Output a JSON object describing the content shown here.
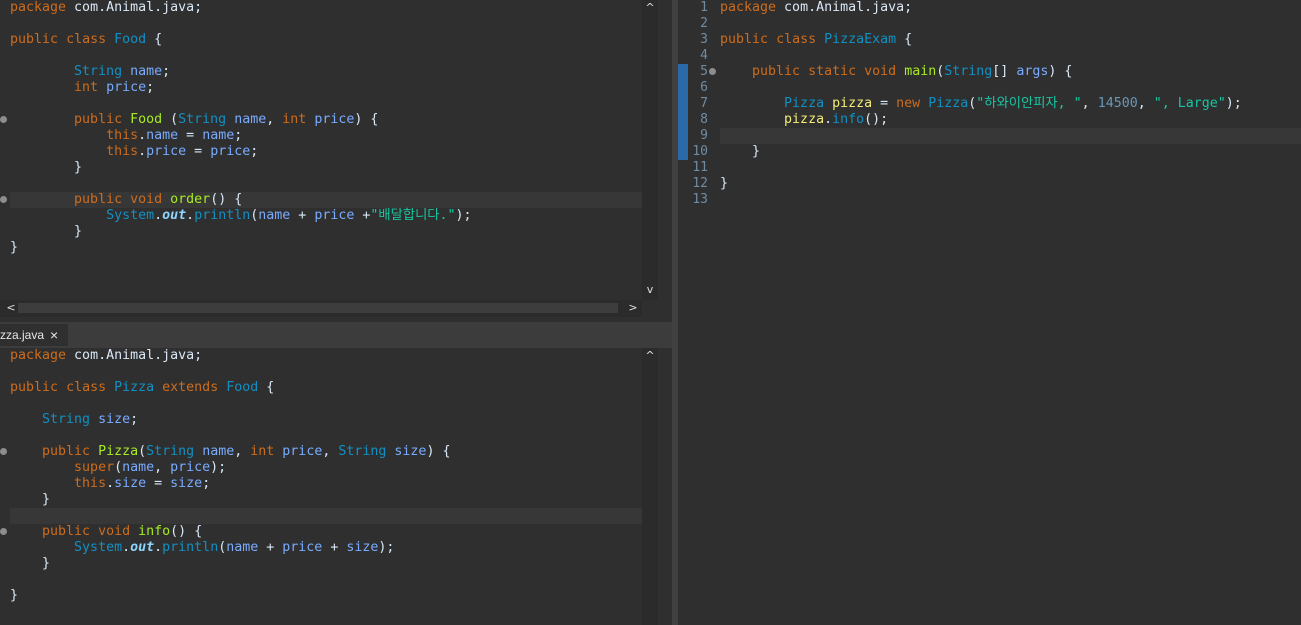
{
  "editors": {
    "food": {
      "lines": [
        [
          [
            "kw",
            "package"
          ],
          [
            "def",
            " com.Animal.java;"
          ]
        ],
        [],
        [
          [
            "kw",
            "public"
          ],
          [
            "def",
            " "
          ],
          [
            "kw",
            "class"
          ],
          [
            "def",
            " "
          ],
          [
            "cls",
            "Food"
          ],
          [
            "def",
            " {"
          ]
        ],
        [],
        [
          [
            "def",
            "        "
          ],
          [
            "cls",
            "String"
          ],
          [
            "def",
            " "
          ],
          [
            "var",
            "name"
          ],
          [
            "def",
            ";"
          ]
        ],
        [
          [
            "def",
            "        "
          ],
          [
            "kw",
            "int"
          ],
          [
            "def",
            " "
          ],
          [
            "var",
            "price"
          ],
          [
            "def",
            ";"
          ]
        ],
        [],
        [
          [
            "def",
            "        "
          ],
          [
            "kw",
            "public"
          ],
          [
            "def",
            " "
          ],
          [
            "mth",
            "Food"
          ],
          [
            "def",
            " ("
          ],
          [
            "cls",
            "String"
          ],
          [
            "def",
            " "
          ],
          [
            "var",
            "name"
          ],
          [
            "def",
            ", "
          ],
          [
            "kw",
            "int"
          ],
          [
            "def",
            " "
          ],
          [
            "var",
            "price"
          ],
          [
            "def",
            ") {"
          ]
        ],
        [
          [
            "def",
            "            "
          ],
          [
            "kw",
            "this"
          ],
          [
            "def",
            "."
          ],
          [
            "var",
            "name"
          ],
          [
            "def",
            " = "
          ],
          [
            "var",
            "name"
          ],
          [
            "def",
            ";"
          ]
        ],
        [
          [
            "def",
            "            "
          ],
          [
            "kw",
            "this"
          ],
          [
            "def",
            "."
          ],
          [
            "var",
            "price"
          ],
          [
            "def",
            " = "
          ],
          [
            "var",
            "price"
          ],
          [
            "def",
            ";"
          ]
        ],
        [
          [
            "def",
            "        }"
          ]
        ],
        [],
        [
          [
            "def",
            "        "
          ],
          [
            "kw",
            "public"
          ],
          [
            "def",
            " "
          ],
          [
            "kw",
            "void"
          ],
          [
            "def",
            " "
          ],
          [
            "mth",
            "order"
          ],
          [
            "def",
            "() {"
          ]
        ],
        [
          [
            "def",
            "            "
          ],
          [
            "cls",
            "System"
          ],
          [
            "def",
            "."
          ],
          [
            "stat",
            "out"
          ],
          [
            "def",
            "."
          ],
          [
            "cls",
            "println"
          ],
          [
            "def",
            "("
          ],
          [
            "var",
            "name"
          ],
          [
            "def",
            " + "
          ],
          [
            "var",
            "price"
          ],
          [
            "def",
            " +"
          ],
          [
            "str",
            "\"배달합니다.\""
          ],
          [
            "def",
            ");"
          ]
        ],
        [
          [
            "def",
            "        }"
          ]
        ],
        [
          [
            "def",
            "}"
          ]
        ]
      ]
    },
    "pizza": {
      "tab_label": "zza.java",
      "lines": [
        [
          [
            "kw",
            "package"
          ],
          [
            "def",
            " com.Animal.java;"
          ]
        ],
        [],
        [
          [
            "kw",
            "public"
          ],
          [
            "def",
            " "
          ],
          [
            "kw",
            "class"
          ],
          [
            "def",
            " "
          ],
          [
            "cls",
            "Pizza"
          ],
          [
            "def",
            " "
          ],
          [
            "kw",
            "extends"
          ],
          [
            "def",
            " "
          ],
          [
            "cls",
            "Food"
          ],
          [
            "def",
            " {"
          ]
        ],
        [],
        [
          [
            "def",
            "    "
          ],
          [
            "cls",
            "String"
          ],
          [
            "def",
            " "
          ],
          [
            "var",
            "size"
          ],
          [
            "def",
            ";"
          ]
        ],
        [],
        [
          [
            "def",
            "    "
          ],
          [
            "kw",
            "public"
          ],
          [
            "def",
            " "
          ],
          [
            "mth",
            "Pizza"
          ],
          [
            "def",
            "("
          ],
          [
            "cls",
            "String"
          ],
          [
            "def",
            " "
          ],
          [
            "var",
            "name"
          ],
          [
            "def",
            ", "
          ],
          [
            "kw",
            "int"
          ],
          [
            "def",
            " "
          ],
          [
            "var",
            "price"
          ],
          [
            "def",
            ", "
          ],
          [
            "cls",
            "String"
          ],
          [
            "def",
            " "
          ],
          [
            "var",
            "size"
          ],
          [
            "def",
            ") {"
          ]
        ],
        [
          [
            "def",
            "        "
          ],
          [
            "kw",
            "super"
          ],
          [
            "def",
            "("
          ],
          [
            "var",
            "name"
          ],
          [
            "def",
            ", "
          ],
          [
            "var",
            "price"
          ],
          [
            "def",
            ");"
          ]
        ],
        [
          [
            "def",
            "        "
          ],
          [
            "kw",
            "this"
          ],
          [
            "def",
            "."
          ],
          [
            "var",
            "size"
          ],
          [
            "def",
            " = "
          ],
          [
            "var",
            "size"
          ],
          [
            "def",
            ";"
          ]
        ],
        [
          [
            "def",
            "    }"
          ]
        ],
        [],
        [
          [
            "def",
            "    "
          ],
          [
            "kw",
            "public"
          ],
          [
            "def",
            " "
          ],
          [
            "kw",
            "void"
          ],
          [
            "def",
            " "
          ],
          [
            "mth",
            "info"
          ],
          [
            "def",
            "() {"
          ]
        ],
        [
          [
            "def",
            "        "
          ],
          [
            "cls",
            "System"
          ],
          [
            "def",
            "."
          ],
          [
            "stat",
            "out"
          ],
          [
            "def",
            "."
          ],
          [
            "cls",
            "println"
          ],
          [
            "def",
            "("
          ],
          [
            "var",
            "name"
          ],
          [
            "def",
            " + "
          ],
          [
            "var",
            "price"
          ],
          [
            "def",
            " + "
          ],
          [
            "var",
            "size"
          ],
          [
            "def",
            ");"
          ]
        ],
        [
          [
            "def",
            "    }"
          ]
        ],
        [],
        [
          [
            "def",
            "}"
          ]
        ]
      ]
    },
    "pizzaexam": {
      "line_numbers": [
        "1",
        "2",
        "3",
        "4",
        "5",
        "6",
        "7",
        "8",
        "9",
        "10",
        "11",
        "12",
        "13"
      ],
      "lines": [
        [
          [
            "kw",
            "package"
          ],
          [
            "def",
            " com.Animal.java;"
          ]
        ],
        [],
        [
          [
            "kw",
            "public"
          ],
          [
            "def",
            " "
          ],
          [
            "kw",
            "class"
          ],
          [
            "def",
            " "
          ],
          [
            "cls",
            "PizzaExam"
          ],
          [
            "def",
            " {"
          ]
        ],
        [],
        [
          [
            "def",
            "    "
          ],
          [
            "kw",
            "public"
          ],
          [
            "def",
            " "
          ],
          [
            "kw",
            "static"
          ],
          [
            "def",
            " "
          ],
          [
            "kw",
            "void"
          ],
          [
            "def",
            " "
          ],
          [
            "mth",
            "main"
          ],
          [
            "def",
            "("
          ],
          [
            "cls",
            "String"
          ],
          [
            "def",
            "[] "
          ],
          [
            "var",
            "args"
          ],
          [
            "def",
            ") {"
          ]
        ],
        [],
        [
          [
            "def",
            "        "
          ],
          [
            "cls",
            "Pizza"
          ],
          [
            "def",
            " "
          ],
          [
            "local",
            "pizza"
          ],
          [
            "def",
            " = "
          ],
          [
            "kw",
            "new"
          ],
          [
            "def",
            " "
          ],
          [
            "cls",
            "Pizza"
          ],
          [
            "def",
            "("
          ],
          [
            "str",
            "\"하와이안피자, \""
          ],
          [
            "def",
            ", "
          ],
          [
            "num",
            "14500"
          ],
          [
            "def",
            ", "
          ],
          [
            "str",
            "\", Large\""
          ],
          [
            "def",
            ");"
          ]
        ],
        [
          [
            "def",
            "        "
          ],
          [
            "local",
            "pizza"
          ],
          [
            "def",
            "."
          ],
          [
            "cls",
            "info"
          ],
          [
            "def",
            "();"
          ]
        ],
        [],
        [
          [
            "def",
            "    }"
          ]
        ],
        [],
        [
          [
            "def",
            "}"
          ]
        ],
        []
      ]
    }
  },
  "scroll": {
    "up": "^",
    "down": "v",
    "left": "<",
    "right": ">"
  },
  "tab_close": "×",
  "colors": {
    "background": "#2f2f2f",
    "keyword": "#cc6c1d",
    "class": "#1290c3",
    "variable": "#79abff",
    "method": "#a7ec21",
    "string": "#17c6a3",
    "change_bar": "#2a6aa8"
  }
}
